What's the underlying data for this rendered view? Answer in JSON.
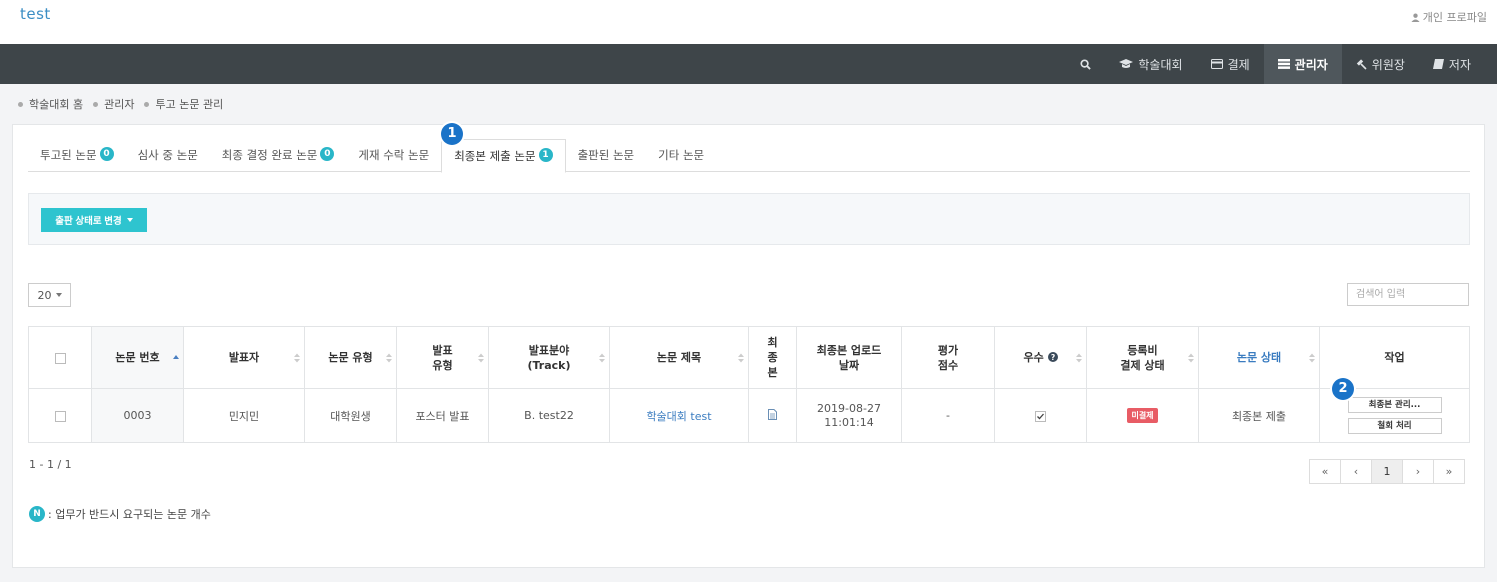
{
  "site": {
    "title": "test",
    "profile_label": "개인 프로파일"
  },
  "nav": {
    "items": [
      {
        "label": "학술대회"
      },
      {
        "label": "결제"
      },
      {
        "label": "관리자"
      },
      {
        "label": "위원장"
      },
      {
        "label": "저자"
      }
    ],
    "active": "관리자"
  },
  "breadcrumb": [
    "학술대회 홈",
    "관리자",
    "투고 논문 관리"
  ],
  "tabs": [
    {
      "label": "투고된 논문",
      "badge": "0"
    },
    {
      "label": "심사 중 논문"
    },
    {
      "label": "최종 결정 완료 논문",
      "badge": "0"
    },
    {
      "label": "게재 수락 논문"
    },
    {
      "label": "최종본 제출 논문",
      "badge": "1"
    },
    {
      "label": "출판된 논문"
    },
    {
      "label": "기타 논문"
    }
  ],
  "active_tab": "최종본 제출 논문",
  "callouts": [
    "1",
    "2"
  ],
  "toolbar": {
    "status_button": "출판 상태로 변경"
  },
  "list": {
    "page_size": "20",
    "search_placeholder": "검색어 입력"
  },
  "table": {
    "headers": {
      "paper_no": "논문 번호",
      "presenter": "발표자",
      "paper_type": "논문 유형",
      "presentation_type": "발표\n유형",
      "field": "발표분야\n(Track)",
      "title": "논문 제목",
      "final": "최\n종\n본",
      "upload_date": "최종본 업로드\n날짜",
      "score": "평가\n점수",
      "excellent": "우수",
      "fee_status": "등록비\n결제 상태",
      "paper_status": "논문 상태",
      "operation": "작업"
    },
    "rows": [
      {
        "paper_no": "0003",
        "presenter": "민지민",
        "paper_type": "대학원생",
        "presentation_type": "포스터 발표",
        "field": "B. test22",
        "title": "학술대회 test",
        "upload_date": "2019-08-27\n11:01:14",
        "score": "-",
        "excellent_checked": true,
        "fee_status": "미결제",
        "paper_status": "최종본 제출",
        "actions": [
          "최종본 관리...",
          "철회 처리"
        ]
      }
    ]
  },
  "pagination": {
    "range": "1 - 1 / 1",
    "first": "«",
    "prev": "‹",
    "current": "1",
    "next": "›",
    "last": "»"
  },
  "legend": {
    "badge": "N",
    "text": ": 업무가 반드시 요구되는 논문 개수"
  },
  "colors": {
    "navbar": "#3e4549",
    "accent": "#2ec4cf",
    "badge": "#29b6c8",
    "callout": "#1a73c8",
    "unpaid": "#e85c65",
    "link": "#3a7cc0"
  }
}
